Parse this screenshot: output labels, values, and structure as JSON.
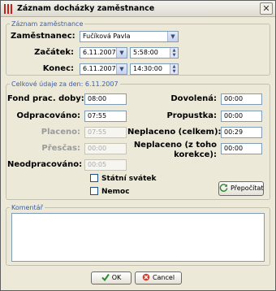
{
  "window": {
    "title": "Záznam docházky zaměstnance",
    "close_glyph": "✕",
    "app_icon": "bars-icon"
  },
  "employee_group": {
    "legend": "Záznam zaměstnance",
    "employee_label": "Zaměstnanec:",
    "employee_value": "Fučíková Pavla",
    "start_label": "Začátek:",
    "start_date": "6.11.2007",
    "start_time": "5:58:00",
    "end_label": "Konec:",
    "end_date": "6.11.2007",
    "end_time": "14:30:00"
  },
  "totals_group": {
    "legend": "Celkové údaje za den: 6.11.2007",
    "fund_label": "Fond prac. doby:",
    "fund_value": "08:00",
    "worked_label": "Odpracováno:",
    "worked_value": "07:55",
    "paid_label": "Placeno:",
    "paid_value": "07:55",
    "overtime_label": "Přesčas:",
    "overtime_value": "00:00",
    "unworked_label": "Neodpracováno:",
    "unworked_value": "00:05",
    "vacation_label": "Dovolená:",
    "vacation_value": "00:00",
    "pass_label": "Propustka:",
    "pass_value": "00:00",
    "unpaid_total_label": "Neplaceno (celkem):",
    "unpaid_total_value": "00:29",
    "unpaid_of_label": "Neplaceno (z toho korekce):",
    "unpaid_of_value": "00:00",
    "holiday_label": "Státní svátek",
    "sick_label": "Nemoc",
    "recalc_label": "Přepočítat",
    "recalc_icon": "refresh-icon"
  },
  "comment_group": {
    "legend": "Komentář",
    "text": ""
  },
  "footer": {
    "ok_label": "OK",
    "ok_icon": "checkmark-icon",
    "cancel_label": "Cancel",
    "cancel_icon": "cancel-icon"
  }
}
